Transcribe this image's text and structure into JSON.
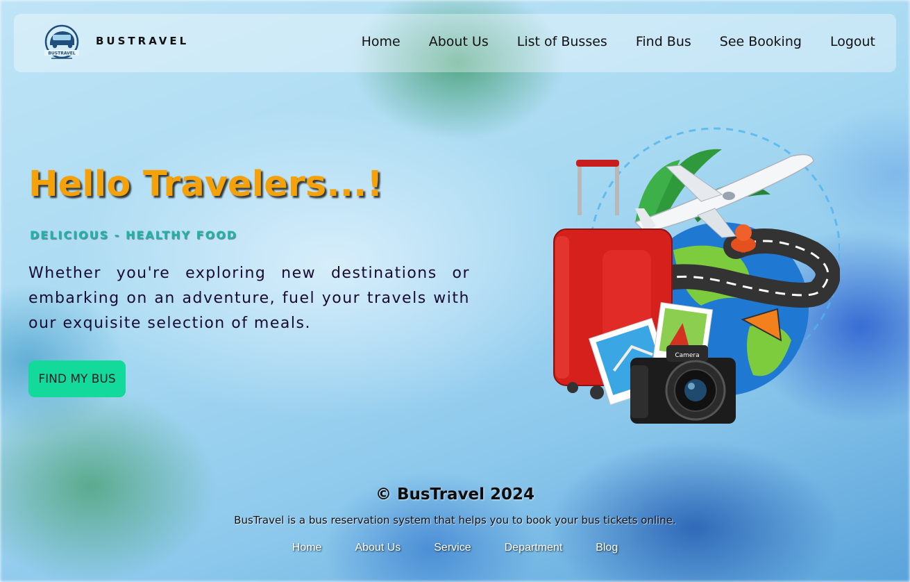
{
  "header": {
    "brand": "BUSTRAVEL",
    "logo_text": "BUSTRAVEL",
    "logo_icon": "bus-logo-icon",
    "nav": [
      {
        "label": "Home"
      },
      {
        "label": "About Us"
      },
      {
        "label": "List of Busses"
      },
      {
        "label": "Find Bus"
      },
      {
        "label": "See Booking"
      },
      {
        "label": "Logout"
      }
    ]
  },
  "hero": {
    "title": "Hello Travelers...!",
    "subtitle": "DELICIOUS - HEALTHY FOOD",
    "text": "Whether you're exploring new destinations or embarking on an adventure, fuel your travels with our exquisite selection of meals.",
    "button_label": "FIND MY BUS",
    "illustration": "travel-illustration",
    "camera_label": "Camera"
  },
  "footer": {
    "copyright": "© BusTravel 2024",
    "description": "BusTravel is a bus reservation system that helps you to book your bus tickets online.",
    "links": [
      {
        "label": "Home"
      },
      {
        "label": "About Us"
      },
      {
        "label": "Service"
      },
      {
        "label": "Department"
      },
      {
        "label": "Blog"
      }
    ]
  },
  "colors": {
    "title": "#f5a10a",
    "subtitle": "#20b3a8",
    "button": "#13d99a",
    "text": "#170b32"
  }
}
